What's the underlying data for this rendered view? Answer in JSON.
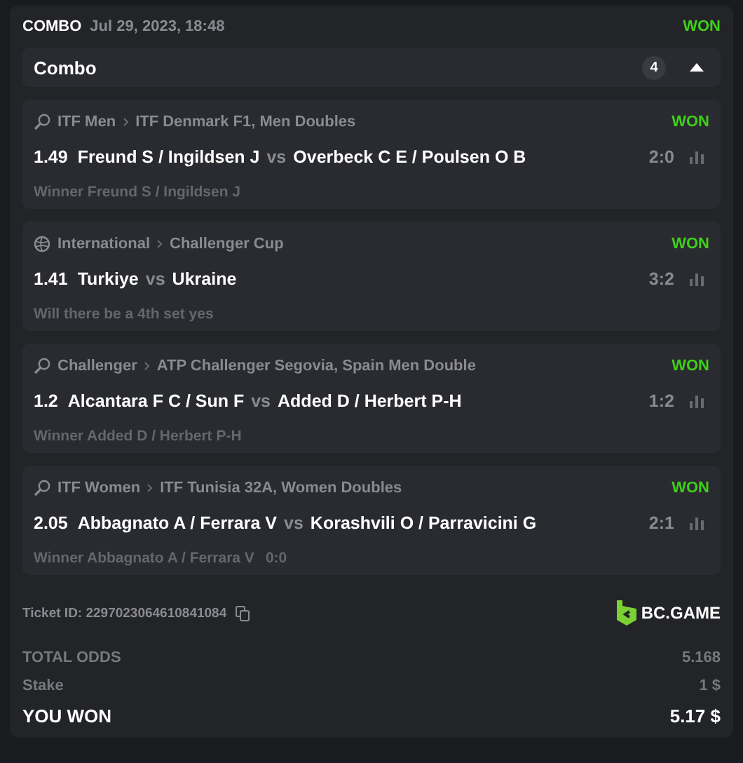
{
  "header": {
    "type": "COMBO",
    "date": "Jul 29, 2023, 18:48",
    "status": "WON"
  },
  "combo": {
    "title": "Combo",
    "count": "4",
    "expanded": true
  },
  "bets": [
    {
      "kind": "tennis",
      "category": "ITF Men",
      "tournament": "ITF Denmark F1, Men Doubles",
      "status": "WON",
      "odds": "1.49",
      "home": "Freund S / Ingildsen J",
      "vs": "vs",
      "away": "Overbeck C E / Poulsen O B",
      "score": "2:0",
      "market": "Winner Freund S / Ingildsen J"
    },
    {
      "kind": "volleyball",
      "category": "International",
      "tournament": "Challenger Cup",
      "status": "WON",
      "odds": "1.41",
      "home": "Turkiye",
      "vs": "vs",
      "away": "Ukraine",
      "score": "3:2",
      "market": "Will there be a 4th set yes"
    },
    {
      "kind": "tennis",
      "category": "Challenger",
      "tournament": "ATP Challenger Segovia, Spain Men Double",
      "status": "WON",
      "odds": "1.2",
      "home": "Alcantara F C / Sun F",
      "vs": "vs",
      "away": "Added D / Herbert P-H",
      "score": "1:2",
      "market": "Winner Added D / Herbert P-H"
    },
    {
      "kind": "tennis",
      "category": "ITF Women",
      "tournament": "ITF Tunisia 32A, Women Doubles",
      "status": "WON",
      "odds": "2.05",
      "home": "Abbagnato A / Ferrara V",
      "vs": "vs",
      "away": "Korashvili O / Parravicini G",
      "score": "2:1",
      "market": "Winner Abbagnato A / Ferrara V",
      "market_score": "0:0"
    }
  ],
  "ticket": {
    "id": "Ticket ID: 2297023064610841084",
    "brand": "BC.GAME"
  },
  "totals": [
    {
      "label": "TOTAL ODDS",
      "value": "5.168",
      "kind": "normal"
    },
    {
      "label": "Stake",
      "value": "1 $",
      "kind": "normal"
    },
    {
      "label": "YOU WON",
      "value": "5.17 $",
      "kind": "total"
    }
  ]
}
